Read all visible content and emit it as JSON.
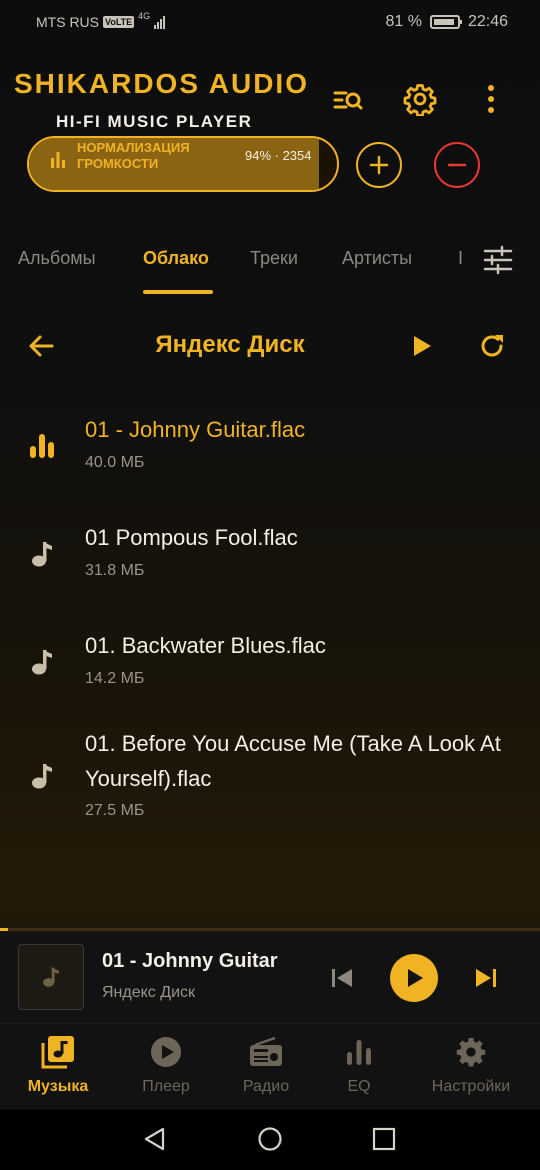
{
  "status_bar": {
    "carrier": "MTS RUS",
    "volte": "VoLTE",
    "network": "4G",
    "battery": "81 %",
    "time": "22:46"
  },
  "header": {
    "title": "SHIKARDOS AUDIO",
    "subtitle": "HI-FI MUSIC PLAYER",
    "icons": [
      "search-list-icon",
      "gear-icon",
      "more-vert-icon"
    ]
  },
  "normalization": {
    "label": "НОРМАЛИЗАЦИЯ ГРОМКОСТИ",
    "value_text": "94% · 2354",
    "level": 0.94
  },
  "tabs": {
    "items": [
      "Альбомы",
      "Облако",
      "Треки",
      "Артисты",
      "I"
    ],
    "active": "Облако"
  },
  "folder": {
    "title": "Яндекс Диск"
  },
  "files": [
    {
      "name": "01 - Johnny Guitar.flac",
      "size": "40.0 МБ",
      "playing": true
    },
    {
      "name": "01 Pompous Fool.flac",
      "size": "31.8 МБ",
      "playing": false
    },
    {
      "name": "01. Backwater Blues.flac",
      "size": "14.2 МБ",
      "playing": false
    },
    {
      "name": "01. Before You Accuse Me (Take A Look At Yourself).flac",
      "size": "27.5 МБ",
      "playing": false
    }
  ],
  "mini_player": {
    "title": "01 - Johnny Guitar",
    "source": "Яндекс Диск",
    "progress": 0.015
  },
  "bottom_nav": {
    "items": [
      "Музыка",
      "Плеер",
      "Радио",
      "EQ",
      "Настройки"
    ],
    "active": "Музыка"
  },
  "colors": {
    "accent": "#f0b324",
    "danger": "#e53935",
    "background": "#0d0d0d",
    "muted": "#8c887f"
  }
}
